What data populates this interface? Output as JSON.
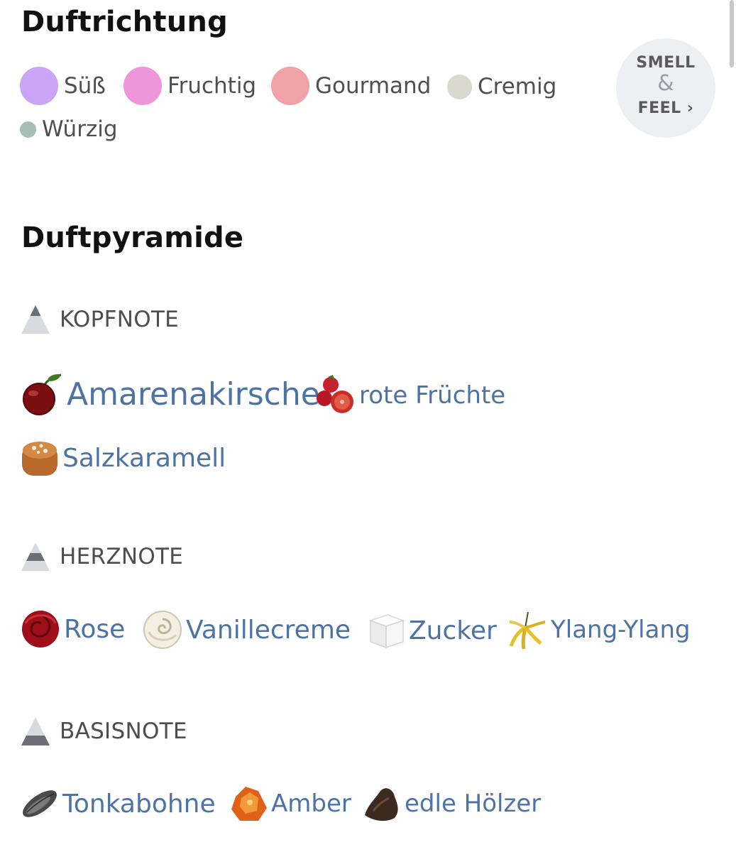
{
  "duftrichtung": {
    "title": "Duftrichtung",
    "accords": [
      {
        "label": "Süß",
        "color": "#caa4f6"
      },
      {
        "label": "Fruchtig",
        "color": "#ef95da"
      },
      {
        "label": "Gourmand",
        "color": "#f0a2a8"
      },
      {
        "label": "Cremig",
        "color": "#d9d9ce"
      },
      {
        "label": "Würzig",
        "color": "#a7bdb6"
      }
    ],
    "smell_feel": {
      "line1": "SMELL",
      "amp": "&",
      "line2": "FEEL ›"
    }
  },
  "duftpyramide": {
    "title": "Duftpyramide",
    "levels": [
      {
        "label": "KOPFNOTE",
        "notes": [
          {
            "label": "Amarenakirsche",
            "icon": "cherry-icon"
          },
          {
            "label": "rote Früchte",
            "icon": "red-fruits-icon"
          },
          {
            "label": "Salzkaramell",
            "icon": "salted-caramel-icon"
          }
        ]
      },
      {
        "label": "HERZNOTE",
        "notes": [
          {
            "label": "Rose",
            "icon": "rose-icon"
          },
          {
            "label": "Vanillecreme",
            "icon": "vanilla-cream-icon"
          },
          {
            "label": "Zucker",
            "icon": "sugar-cube-icon"
          },
          {
            "label": "Ylang-Ylang",
            "icon": "ylang-ylang-flower-icon"
          }
        ]
      },
      {
        "label": "BASISNOTE",
        "notes": [
          {
            "label": "Tonkabohne",
            "icon": "tonka-bean-icon"
          },
          {
            "label": "Amber",
            "icon": "amber-icon"
          },
          {
            "label": "edle Hölzer",
            "icon": "precious-woods-icon"
          }
        ]
      }
    ]
  }
}
